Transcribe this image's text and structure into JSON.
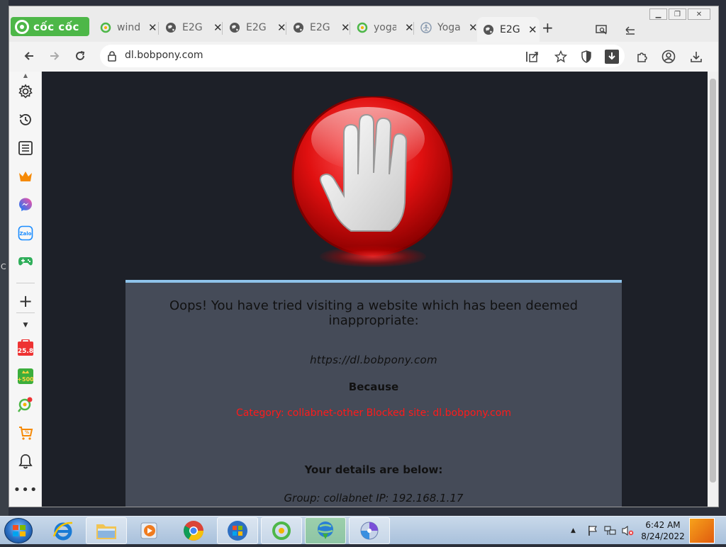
{
  "window": {
    "controls": [
      "minimize",
      "restore",
      "close"
    ]
  },
  "brand": {
    "name": "cốc cốc"
  },
  "tabs": [
    {
      "title": "wind",
      "icon": "coccoc-leaf-icon"
    },
    {
      "title": "E2G",
      "icon": "globe-icon"
    },
    {
      "title": "E2G",
      "icon": "globe-icon"
    },
    {
      "title": "E2G",
      "icon": "globe-icon"
    },
    {
      "title": "yoga",
      "icon": "coccoc-leaf-icon"
    },
    {
      "title": "Yoga",
      "icon": "yoga-icon"
    },
    {
      "title": "E2G",
      "icon": "globe-icon",
      "active": true
    }
  ],
  "address": {
    "url": "dl.bobpony.com"
  },
  "sidebar": {
    "badges": {
      "calendar": "25.8",
      "coin": "+500"
    }
  },
  "block_page": {
    "title": "Oops! You have tried visiting a website which has been deemed inappropriate:",
    "url": "https://dl.bobpony.com",
    "because": "Because",
    "reason": "Category: collabnet-other   Blocked site: dl.bobpony.com",
    "details_heading": "Your details are below:",
    "details": "Group: collabnet   IP: 192.168.1.17"
  },
  "taskbar": {
    "time": "6:42 AM",
    "date": "8/24/2022"
  },
  "colors": {
    "accent": "#4db748",
    "reason_red": "#ff1a1a",
    "panel_bg": "#454b58",
    "page_bg": "#1d2028",
    "panel_border": "#8ec3ea"
  }
}
